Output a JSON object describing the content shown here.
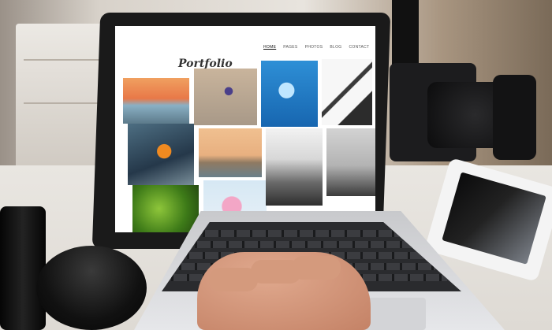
{
  "site": {
    "logo": "Portfolio",
    "nav": [
      "HOME",
      "PAGES",
      "PHOTOS",
      "BLOG",
      "CONTACT"
    ],
    "active_nav_index": 0
  },
  "colors": {
    "screen_bg": "#ffffff",
    "laptop_lid": "#1a1a1a",
    "keyboard": "#2a2b2e"
  },
  "gallery": {
    "tiles": [
      {
        "name": "sunset-harbor-photo",
        "icon": "image-icon"
      },
      {
        "name": "starfish-photo",
        "icon": "image-icon"
      },
      {
        "name": "green-leaves-photo",
        "icon": "image-icon"
      },
      {
        "name": "purple-flower-photo",
        "icon": "image-icon"
      },
      {
        "name": "coastal-town-photo",
        "icon": "image-icon"
      },
      {
        "name": "pink-blossom-photo",
        "icon": "image-icon"
      },
      {
        "name": "jellyfish-photo",
        "icon": "image-icon"
      },
      {
        "name": "misty-mountain-village-photo",
        "icon": "image-icon"
      },
      {
        "name": "bridge-structure-photo",
        "icon": "image-icon"
      },
      {
        "name": "winter-cabin-photo",
        "icon": "image-icon"
      }
    ]
  }
}
